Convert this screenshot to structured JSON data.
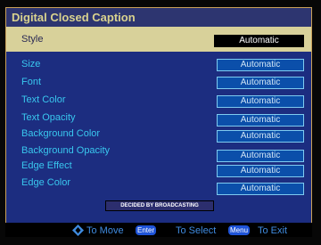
{
  "dialog": {
    "title": "Digital Closed Caption"
  },
  "selected_row": {
    "label": "Style",
    "value": "Automatic"
  },
  "rows": [
    {
      "label": "Size",
      "value": "Automatic"
    },
    {
      "label": "Font",
      "value": "Automatic"
    },
    {
      "label": "Text Color",
      "value": "Automatic"
    },
    {
      "label": "Text Opacity",
      "value": "Automatic"
    },
    {
      "label": "Background Color",
      "value": "Automatic"
    },
    {
      "label": "Background Opacity",
      "value": "Automatic"
    },
    {
      "label": "Edge Effect",
      "value": "Automatic"
    },
    {
      "label": "Edge Color",
      "value": "Automatic"
    }
  ],
  "badge": "DECIDED BY BROADCASTING",
  "footer": {
    "move_text": "To Move",
    "enter_key": "Enter",
    "select_text": "To Select",
    "menu_key": "Menu",
    "exit_text": "To Exit",
    "dpad_icon": "dpad-arrows-icon"
  },
  "colors": {
    "panel_bg": "#1c2d80",
    "highlight": "#d8d19a",
    "label_blue": "#39c7ee",
    "value_box": "#0b4faa"
  }
}
